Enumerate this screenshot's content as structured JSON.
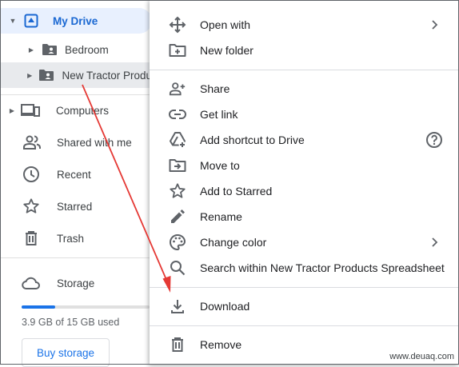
{
  "sidebar": {
    "my_drive": "My Drive",
    "folders": [
      "Bedroom",
      "New Tractor Produ"
    ],
    "items": [
      {
        "label": "Computers",
        "icon": "computers-icon"
      },
      {
        "label": "Shared with me",
        "icon": "shared-with-me-icon"
      },
      {
        "label": "Recent",
        "icon": "clock-icon"
      },
      {
        "label": "Starred",
        "icon": "star-icon"
      },
      {
        "label": "Trash",
        "icon": "trash-icon"
      }
    ],
    "storage_label": "Storage",
    "storage_used": "3.9 GB of 15 GB used",
    "storage_fraction": 0.26,
    "buy_storage": "Buy storage"
  },
  "context_menu": {
    "items": [
      {
        "label": "Open with",
        "icon": "move-arrows-icon",
        "submenu": true
      },
      {
        "label": "New folder",
        "icon": "new-folder-icon"
      },
      {
        "label": "Share",
        "icon": "add-person-icon"
      },
      {
        "label": "Get link",
        "icon": "link-icon"
      },
      {
        "label": "Add shortcut to Drive",
        "icon": "add-shortcut-icon",
        "help": true
      },
      {
        "label": "Move to",
        "icon": "move-to-folder-icon"
      },
      {
        "label": "Add to Starred",
        "icon": "star-outline-icon"
      },
      {
        "label": "Rename",
        "icon": "pencil-icon"
      },
      {
        "label": "Change color",
        "icon": "palette-icon",
        "submenu": true
      },
      {
        "label": "Search within New Tractor Products Spreadsheet",
        "icon": "search-icon"
      },
      {
        "label": "Download",
        "icon": "download-icon"
      },
      {
        "label": "Remove",
        "icon": "trash-icon"
      }
    ]
  },
  "watermark": "www.deuaq.com",
  "colors": {
    "accent": "#1a73e8",
    "selected_bg": "#e8f0fe",
    "annotation": "#e53935"
  }
}
